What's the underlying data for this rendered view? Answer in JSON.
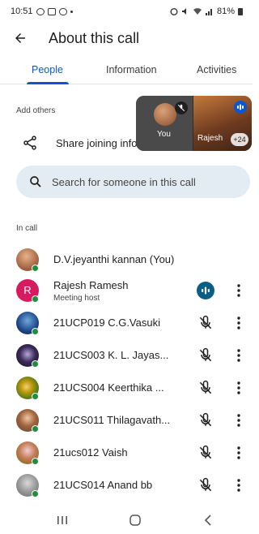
{
  "status_bar": {
    "time": "10:51",
    "battery": "81%",
    "left_icons": [
      "whatsapp-icon",
      "gallery-icon",
      "chat-icon"
    ],
    "right_icons": [
      "alarm-icon",
      "mute-icon",
      "volte-icon",
      "wifi-icon",
      "signal-icon",
      "battery-icon"
    ]
  },
  "header": {
    "title": "About this call",
    "back_icon": "arrow-left-icon"
  },
  "tabs": [
    {
      "label": "People",
      "active": true
    },
    {
      "label": "Information",
      "active": false
    },
    {
      "label": "Activities",
      "active": false
    }
  ],
  "add_others": {
    "label": "Add others",
    "share_label": "Share joining info"
  },
  "pip": {
    "self_label": "You",
    "other_label": "Rajesh",
    "extra_count": "+24"
  },
  "search": {
    "placeholder": "Search for someone in this call"
  },
  "in_call": {
    "label": "In call",
    "participants": [
      {
        "name": "D.V.jeyanthi kannan (You)",
        "subtitle": "",
        "mic": "none",
        "avatar": "photo-pink"
      },
      {
        "name": "Rajesh Ramesh",
        "subtitle": "Meeting host",
        "mic": "speaking",
        "avatar_initial": "R"
      },
      {
        "name": "21UCP019 C.G.Vasuki",
        "subtitle": "",
        "mic": "muted",
        "avatar": "photo-blue"
      },
      {
        "name": "21UCS003 K. L. Jayas...",
        "subtitle": "",
        "mic": "muted",
        "avatar": "photo-dark"
      },
      {
        "name": "21UCS004 Keerthika ...",
        "subtitle": "",
        "mic": "muted",
        "avatar": "photo-flower"
      },
      {
        "name": "21UCS011 Thilagavath...",
        "subtitle": "",
        "mic": "muted",
        "avatar": "photo-girl"
      },
      {
        "name": "21ucs012 Vaish",
        "subtitle": "",
        "mic": "muted",
        "avatar": "photo-child"
      },
      {
        "name": "21UCS014 Anand bb",
        "subtitle": "",
        "mic": "muted",
        "avatar": "photo-grey"
      }
    ]
  },
  "colors": {
    "accent": "#0b57d0",
    "online": "#1e8e3e",
    "host_avatar": "#d81b60",
    "search_bg": "#e4ecf3"
  }
}
